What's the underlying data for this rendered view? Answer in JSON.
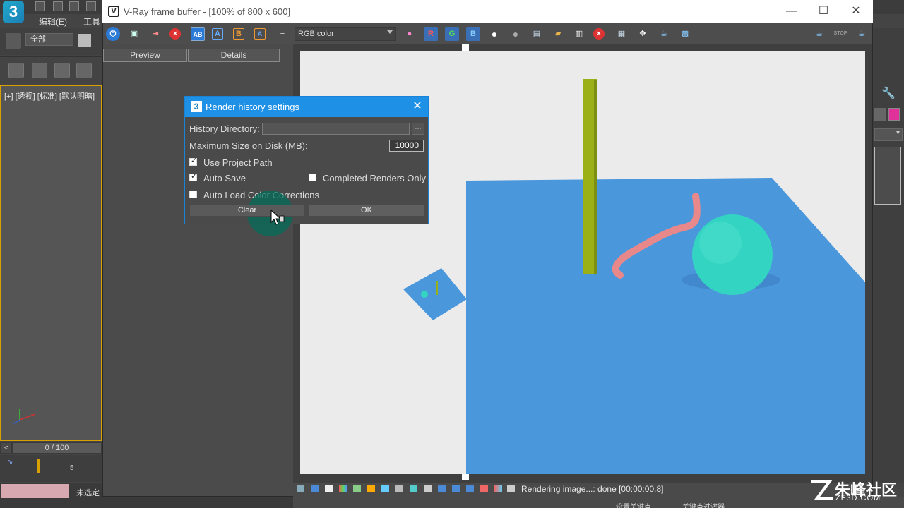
{
  "max": {
    "menu_edit": "编辑(E)",
    "menu_tools": "工具",
    "selection_set": "全部",
    "viewport_label": "[+] [透视] [标准] [默认明暗]",
    "frame_counter": "0 / 100",
    "track_tick": "5",
    "status_text": "未选定",
    "bottom_bar_item1": "设置关键点",
    "bottom_bar_item2": "关键点过滤器"
  },
  "vfb": {
    "title": "V-Ray frame buffer - [100% of 800 x 600]",
    "channel": "RGB color",
    "tab_preview": "Preview",
    "tab_details": "Details",
    "status_text": "Rendering image...: done [00:00:00.8]",
    "btn_r": "R",
    "btn_g": "G",
    "btn_b": "B",
    "btn_a": "A",
    "btn_bb": "B",
    "btn_ab": "AB"
  },
  "dialog": {
    "title": "Render history settings",
    "history_directory_label": "History Directory:",
    "history_directory_value": "",
    "browse_label": "...",
    "max_size_label": "Maximum Size on Disk (MB):",
    "max_size_value": "10000",
    "use_project_path_label": "Use Project Path",
    "use_project_path_checked": true,
    "auto_save_label": "Auto Save",
    "auto_save_checked": true,
    "completed_renders_only_label": "Completed Renders Only",
    "completed_renders_only_checked": false,
    "auto_load_cc_label": "Auto Load Color Corrections",
    "auto_load_cc_checked": false,
    "clear_label": "Clear",
    "ok_label": "OK"
  },
  "watermark": {
    "text": "朱峰社区",
    "sub": "ZF3D.COM"
  },
  "colors": {
    "dialog_title_bg": "#1e90e6",
    "render_plane": "#4b97dc",
    "render_pillar": "#9bb017",
    "render_sphere": "#34d4c2",
    "render_tube": "#e8888a",
    "render_background": "#ebebeb"
  }
}
